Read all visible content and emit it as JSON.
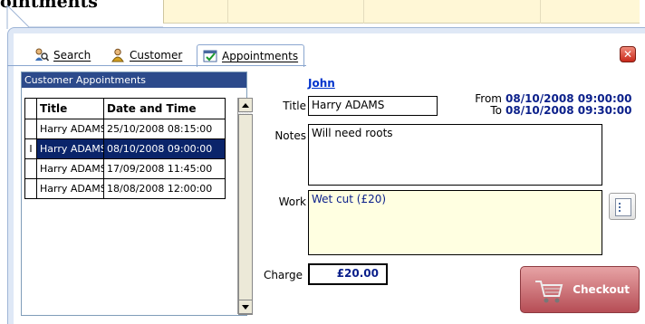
{
  "header": {
    "title_fragment": "ointments"
  },
  "tabs": [
    {
      "label": "Search",
      "icon": "search-users-icon",
      "active": false
    },
    {
      "label": "Customer",
      "icon": "customer-icon",
      "active": false
    },
    {
      "label": "Appointments",
      "icon": "appointments-icon",
      "active": true
    }
  ],
  "close_icon": "close-icon",
  "left_panel": {
    "header": "Customer Appointments",
    "columns": [
      "Title",
      "Date and Time"
    ],
    "rows": [
      {
        "title": "Harry ADAMS",
        "datetime": "25/10/2008 08:15:00",
        "selected": false,
        "marker": ""
      },
      {
        "title": "Harry ADAMS",
        "datetime": "08/10/2008 09:00:00",
        "selected": true,
        "marker": "I"
      },
      {
        "title": "Harry ADAMS",
        "datetime": "17/09/2008 11:45:00",
        "selected": false,
        "marker": ""
      },
      {
        "title": "Harry ADAMS",
        "datetime": "18/08/2008 12:00:00",
        "selected": false,
        "marker": ""
      }
    ]
  },
  "form": {
    "customer_name": "John",
    "title_label": "Title",
    "title_value": "Harry ADAMS",
    "from_label": "From",
    "from_value": "08/10/2008 09:00:00",
    "to_label": "To",
    "to_value": "08/10/2008 09:30:00",
    "notes_label": "Notes",
    "notes_value": "Will need roots",
    "work_label": "Work",
    "work_value": "Wet cut (£20)",
    "charge_label": "Charge",
    "charge_value": "£20.00",
    "checkout_label": "Checkout"
  },
  "colors": {
    "panel_header": "#2c4a8b",
    "selected_row": "#0a246a",
    "date_text": "#0a1f8a",
    "work_background": "#ffffe1",
    "checkout_button": "#c9646b"
  }
}
